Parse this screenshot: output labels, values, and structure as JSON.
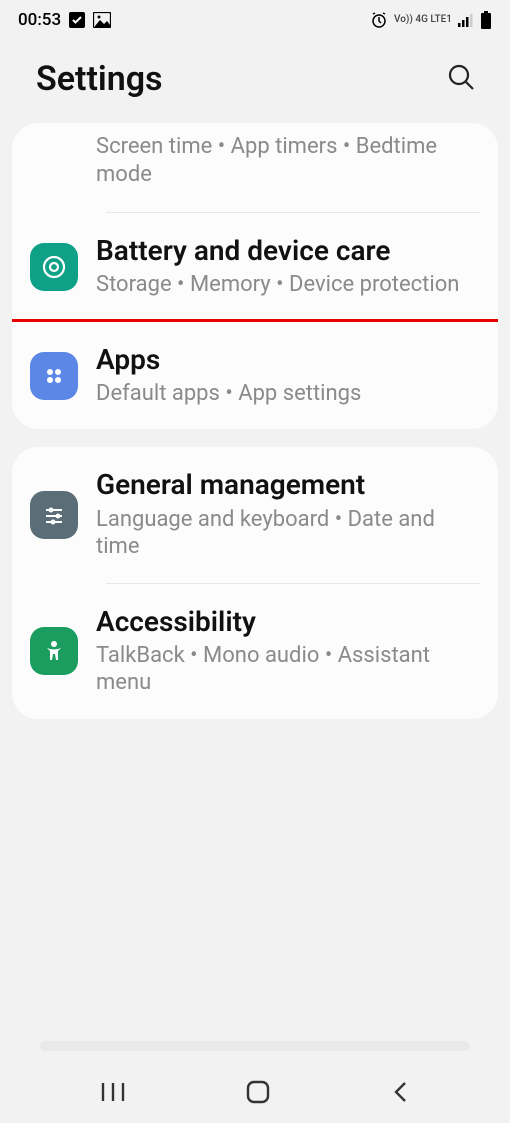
{
  "status": {
    "time": "00:53",
    "network_label": "Vo)) 4G LTE1"
  },
  "header": {
    "title": "Settings"
  },
  "cards": [
    {
      "rows": [
        {
          "title": "",
          "sub": "Screen time  •  App timers  •  Bedtime mode",
          "icon": null
        },
        {
          "title": "Battery and device care",
          "sub": "Storage  •  Memory  •  Device protection",
          "icon": "device-care",
          "icon_color": "#0fa187"
        },
        {
          "title": "Apps",
          "sub": "Default apps  •  App settings",
          "icon": "apps",
          "icon_color": "#5d87e6",
          "highlight": true
        }
      ]
    },
    {
      "rows": [
        {
          "title": "General management",
          "sub": "Language and keyboard  •  Date and time",
          "icon": "sliders",
          "icon_color": "#5b6e78"
        },
        {
          "title": "Accessibility",
          "sub": "TalkBack  •  Mono audio  •  Assistant menu",
          "icon": "accessibility",
          "icon_color": "#1b9d5f"
        }
      ]
    }
  ]
}
